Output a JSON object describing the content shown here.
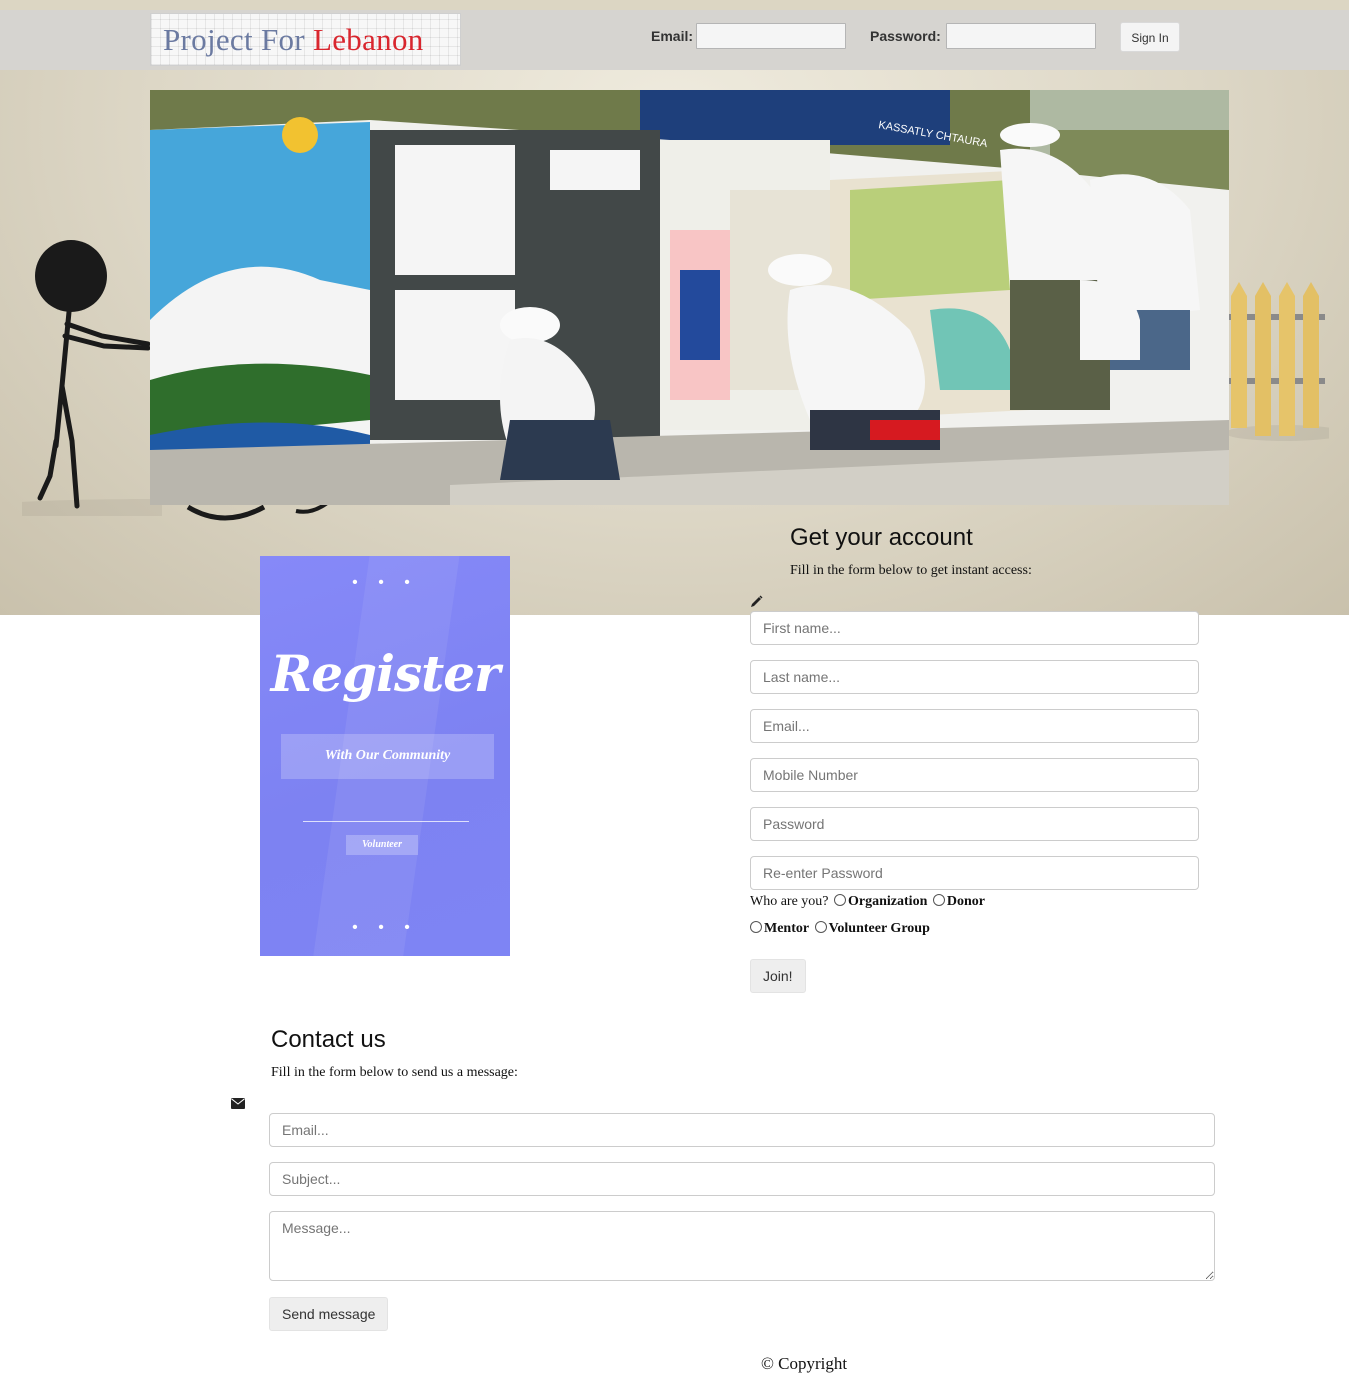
{
  "header": {
    "logo_part1": "Project For",
    "logo_part2": "Lebanon",
    "email_label": "Email:",
    "password_label": "Password:",
    "signin_label": "Sign In"
  },
  "banner": {
    "sign_text": "KASSATLY CHTAURA"
  },
  "promo": {
    "dots_top": "• • •",
    "title": "Register",
    "subtitle": "With Our Community",
    "badge": "Volunteer",
    "dots_bottom": "• • •"
  },
  "account": {
    "heading": "Get your account",
    "intro": "Fill in the form below to get instant access:",
    "first_name_placeholder": "First name...",
    "last_name_placeholder": "Last name...",
    "email_placeholder": "Email...",
    "mobile_placeholder": "Mobile Number",
    "password_placeholder": "Password",
    "repassword_placeholder": "Re-enter Password",
    "who_label": "Who are you?",
    "roles": [
      "Organization",
      "Donor",
      "Mentor",
      "Volunteer Group"
    ],
    "join_label": "Join!"
  },
  "contact": {
    "heading": "Contact us",
    "intro": "Fill in the form below to send us a message:",
    "email_placeholder": "Email...",
    "subject_placeholder": "Subject...",
    "message_placeholder": "Message...",
    "send_label": "Send message"
  },
  "footer": {
    "copyright": "© Copyright"
  }
}
